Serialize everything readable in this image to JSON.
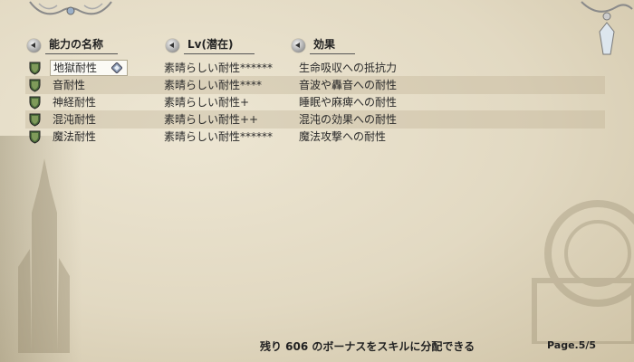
{
  "headers": {
    "name": "能力の名称",
    "level": "Lv(潜在)",
    "effect": "効果"
  },
  "rows": [
    {
      "name": "地獄耐性",
      "level": "素晴らしい耐性******",
      "effect": "生命吸収への抵抗力",
      "selected": true
    },
    {
      "name": "音耐性",
      "level": "素晴らしい耐性****",
      "effect": "音波や轟音への耐性"
    },
    {
      "name": "神経耐性",
      "level": "素晴らしい耐性+",
      "effect": "睡眠や麻痺への耐性"
    },
    {
      "name": "混沌耐性",
      "level": "素晴らしい耐性++",
      "effect": "混沌の効果への耐性"
    },
    {
      "name": "魔法耐性",
      "level": "素晴らしい耐性******",
      "effect": "魔法攻撃への耐性"
    }
  ],
  "footer": {
    "message": "残り 606 のボーナスをスキルに分配できる",
    "page": "Page.5/5"
  },
  "icons": {
    "row_icon": "shield-icon",
    "sort": "sort-arrow-icon",
    "selection": "diamond-cursor-icon"
  },
  "colors": {
    "parchment": "#e2d9c2",
    "shield_green": "#4a6a3a",
    "text": "#2a2a2a"
  }
}
